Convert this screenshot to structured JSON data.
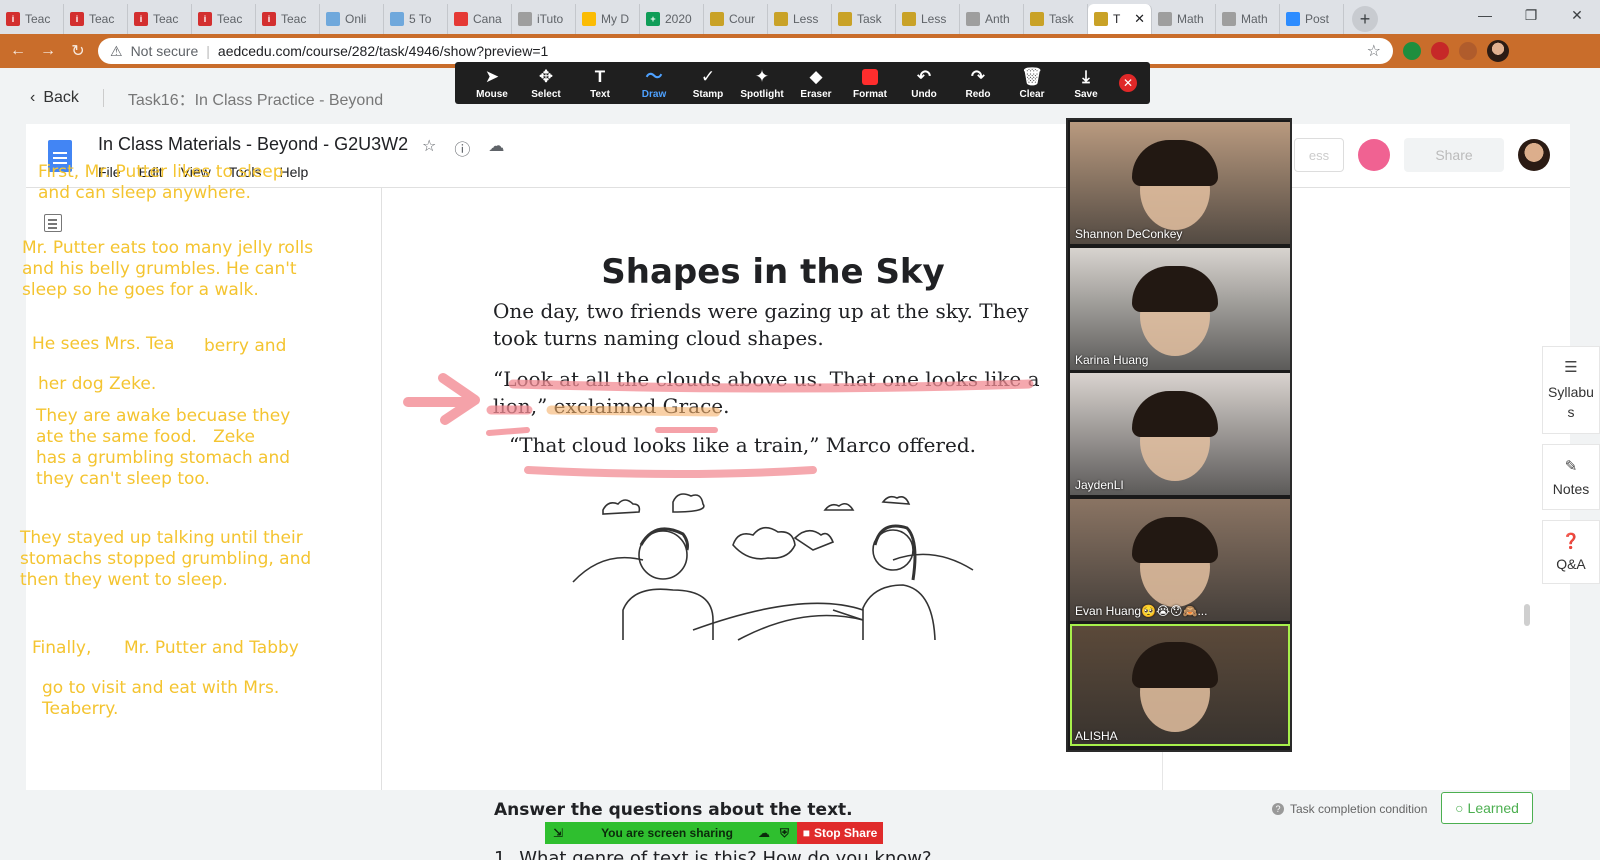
{
  "browser": {
    "tabs": [
      {
        "label": "Teac",
        "fav_color": "#d32f2f",
        "fav_glyph": "i"
      },
      {
        "label": "Teac",
        "fav_color": "#d32f2f",
        "fav_glyph": "i"
      },
      {
        "label": "Teac",
        "fav_color": "#d32f2f",
        "fav_glyph": "i"
      },
      {
        "label": "Teac",
        "fav_color": "#d32f2f",
        "fav_glyph": "i"
      },
      {
        "label": "Teac",
        "fav_color": "#d32f2f",
        "fav_glyph": "i"
      },
      {
        "label": "Onli",
        "fav_color": "#6fa8dc",
        "fav_glyph": ""
      },
      {
        "label": "5 To",
        "fav_color": "#6fa8dc",
        "fav_glyph": ""
      },
      {
        "label": "Cana",
        "fav_color": "#e53935",
        "fav_glyph": ""
      },
      {
        "label": "iTuto",
        "fav_color": "#9e9e9e",
        "fav_glyph": ""
      },
      {
        "label": "My D",
        "fav_color": "#fbbc04",
        "fav_glyph": ""
      },
      {
        "label": "2020",
        "fav_color": "#0f9d58",
        "fav_glyph": "+"
      },
      {
        "label": "Cour",
        "fav_color": "#c9a227",
        "fav_glyph": ""
      },
      {
        "label": "Less",
        "fav_color": "#c9a227",
        "fav_glyph": ""
      },
      {
        "label": "Task",
        "fav_color": "#c9a227",
        "fav_glyph": ""
      },
      {
        "label": "Less",
        "fav_color": "#c9a227",
        "fav_glyph": ""
      },
      {
        "label": "Anth",
        "fav_color": "#9e9e9e",
        "fav_glyph": ""
      },
      {
        "label": "Task",
        "fav_color": "#c9a227",
        "fav_glyph": ""
      },
      {
        "label": "T",
        "fav_color": "#c9a227",
        "fav_glyph": "",
        "active": true
      },
      {
        "label": "Math",
        "fav_color": "#9e9e9e",
        "fav_glyph": ""
      },
      {
        "label": "Math",
        "fav_color": "#9e9e9e",
        "fav_glyph": ""
      },
      {
        "label": "Post",
        "fav_color": "#2d8cff",
        "fav_glyph": ""
      }
    ],
    "new_tab": "+",
    "security": "Not secure",
    "url": "aedcedu.com/course/282/task/4946/show?preview=1"
  },
  "nav": {
    "back_label": "Back",
    "task_title": "Task16：In Class Practice - Beyond"
  },
  "annotate": {
    "tools": [
      {
        "label": "Mouse",
        "icon": "➤",
        "name": "mouse"
      },
      {
        "label": "Select",
        "icon": "✥",
        "name": "select"
      },
      {
        "label": "Text",
        "icon": "T",
        "name": "text"
      },
      {
        "label": "Draw",
        "icon": "〜",
        "name": "draw",
        "active": true
      },
      {
        "label": "Stamp",
        "icon": "✓",
        "name": "stamp"
      },
      {
        "label": "Spotlight",
        "icon": "✦",
        "name": "spotlight"
      },
      {
        "label": "Eraser",
        "icon": "◆",
        "name": "eraser"
      },
      {
        "label": "Format",
        "icon": "",
        "name": "format"
      },
      {
        "label": "Undo",
        "icon": "↶",
        "name": "undo"
      },
      {
        "label": "Redo",
        "icon": "↷",
        "name": "redo"
      },
      {
        "label": "Clear",
        "icon": "🗑",
        "name": "clear"
      },
      {
        "label": "Save",
        "icon": "⤓",
        "name": "save"
      }
    ],
    "close": "✕"
  },
  "doc": {
    "title": "In Class Materials - Beyond - G2U3W2",
    "menu": [
      "File",
      "Edit",
      "View",
      "Tools",
      "Help"
    ],
    "faded_button": "ess",
    "share_label": "Share"
  },
  "worksheet": {
    "title": "Shapes in the Sky",
    "para1": "One day, two friends were gazing up at the sky. They took turns naming cloud shapes.",
    "quote1": "“Look at all the clouds above us. That one looks like a lion,” exclaimed Grace.",
    "quote2": "“That cloud looks like a train,” Marco offered.",
    "questions_heading": "Answer the questions about the text.",
    "q1_number": "1.",
    "q1_text": "What genre of text is this? How do you know?"
  },
  "notes": {
    "n1": "First, Mr. Putter likes to sleep\nand can sleep anywhere.",
    "n2": "Mr. Putter eats too many jelly rolls\nand his belly grumbles. He can't\nsleep so he goes for a walk.",
    "n3a": "He sees Mrs. Tea",
    "n3b": "berry and",
    "n4": "her dog Zeke.",
    "n5": "They are awake becuase they\nate the same food.   Zeke\nhas a grumbling stomach and\nthey can't sleep too.",
    "n6": "They stayed up talking until their\nstomachs stopped grumbling, and\nthen they went to sleep.",
    "n7a": "Finally,",
    "n7b": "Mr. Putter and Tabby",
    "n8": "go to visit and eat with Mrs.\nTeaberry."
  },
  "sidebar": {
    "syllabus": "Syllabus",
    "notes": "Notes",
    "qa": "Q&A"
  },
  "participants": [
    {
      "name": "Shannon DeConkey",
      "bg": "#b99a7f"
    },
    {
      "name": "Karina Huang",
      "bg": "#d8d4cf"
    },
    {
      "name": "JaydenLI",
      "bg": "#d9d3cf"
    },
    {
      "name": "Evan Huang🥺😭😯🙈...",
      "bg": "#8a7463"
    },
    {
      "name": "ALISHA",
      "bg": "#5c4a3a",
      "speaking": true
    }
  ],
  "footer": {
    "completion": "Task completion condition",
    "learned": "Learned",
    "sharing_status": "You are screen sharing",
    "stop_share": "Stop Share"
  },
  "colors": {
    "accent_orange": "#c96d2b",
    "note_yellow": "#f4c430",
    "highlight_pink": "#f28b93",
    "learned_green": "#4caf50"
  }
}
